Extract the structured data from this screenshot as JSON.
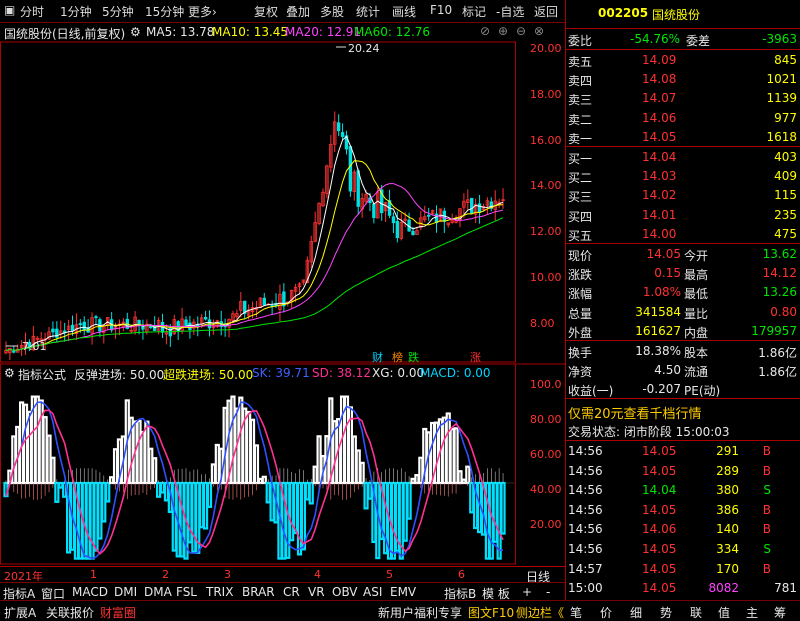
{
  "toolbar": {
    "items": [
      "分时",
      "1分钟",
      "5分钟",
      "15分钟",
      "更多›",
      "复权",
      "叠加",
      "多股",
      "统计",
      "画线",
      "F10",
      "标记",
      "-自选",
      "返回"
    ]
  },
  "header": {
    "stock_title": "国统股份(日线,前复权)",
    "ma5": "MA5: 13.78",
    "ma10": "MA10: 13.45",
    "ma20": "MA20: 12.91",
    "ma60": "MA60: 12.76"
  },
  "price_chart": {
    "y_ticks": [
      "20.00",
      "18.00",
      "16.00",
      "14.00",
      "12.00",
      "10.00",
      "8.00"
    ],
    "high_label": "20.24",
    "low_label": "7.01",
    "badges": {
      "cai": "财",
      "bang": "榜",
      "die": "跌",
      "zhang": "涨"
    }
  },
  "indicator": {
    "title": "指标公式",
    "name": "反弹进场: 50.00",
    "chao": "超跌进场: 50.00",
    "sk": "SK: 39.71",
    "sd": "SD: 38.12",
    "xg": "XG: 0.00",
    "macd": "MACD: 0.00",
    "y_ticks": [
      "100.0",
      "80.00",
      "60.00",
      "40.00",
      "20.00"
    ]
  },
  "timeline": {
    "year": "2021年",
    "months": [
      "1",
      "2",
      "3",
      "4",
      "5",
      "6"
    ],
    "right_label": "日线"
  },
  "tabs": {
    "items": [
      "指标A",
      "窗口",
      "MACD",
      "DMI",
      "DMA",
      "FSL",
      "TRIX",
      "BRAR",
      "CR",
      "VR",
      "OBV",
      "ASI",
      "EMV",
      "指标B",
      "模 板",
      "+",
      "-"
    ]
  },
  "bottom": {
    "left": [
      "扩展A",
      "关联报价",
      "财富圈"
    ],
    "right": [
      "新用户福利专享",
      "图文F10",
      "侧边栏《"
    ],
    "right_tabs": [
      "笔",
      "价",
      "细",
      "势",
      "联",
      "值",
      "主",
      "筹"
    ]
  },
  "quote": {
    "code": "002205",
    "name": "国统股份",
    "weibi_label": "委比",
    "weibi_value": "-54.76%",
    "weicha_label": "委差",
    "weicha_value": "-3963",
    "sells": [
      {
        "label": "卖五",
        "price": "14.09",
        "vol": "845"
      },
      {
        "label": "卖四",
        "price": "14.08",
        "vol": "1021"
      },
      {
        "label": "卖三",
        "price": "14.07",
        "vol": "1139"
      },
      {
        "label": "卖二",
        "price": "14.06",
        "vol": "977"
      },
      {
        "label": "卖一",
        "price": "14.05",
        "vol": "1618"
      }
    ],
    "buys": [
      {
        "label": "买一",
        "price": "14.04",
        "vol": "403"
      },
      {
        "label": "买二",
        "price": "14.03",
        "vol": "409"
      },
      {
        "label": "买三",
        "price": "14.02",
        "vol": "115"
      },
      {
        "label": "买四",
        "price": "14.01",
        "vol": "235"
      },
      {
        "label": "买五",
        "price": "14.00",
        "vol": "475"
      }
    ],
    "stats": [
      {
        "l1": "现价",
        "v1": "14.05",
        "l2": "今开",
        "v2": "13.62"
      },
      {
        "l1": "涨跌",
        "v1": "0.15",
        "l2": "最高",
        "v2": "14.12"
      },
      {
        "l1": "涨幅",
        "v1": "1.08%",
        "l2": "最低",
        "v2": "13.26"
      },
      {
        "l1": "总量",
        "v1": "341584",
        "l2": "量比",
        "v2": "0.80"
      },
      {
        "l1": "外盘",
        "v1": "161627",
        "l2": "内盘",
        "v2": "179957"
      }
    ],
    "stats2": [
      {
        "l1": "换手",
        "v1": "18.38%",
        "l2": "股本",
        "v2": "1.86亿"
      },
      {
        "l1": "净资",
        "v1": "4.50",
        "l2": "流通",
        "v2": "1.86亿"
      },
      {
        "l1": "收益(一)",
        "v1": "-0.207",
        "l2": "PE(动)",
        "v2": ""
      }
    ],
    "promo": "仅需20元查看千档行情",
    "status": "交易状态: 闭市阶段 15:00:03",
    "ticks": [
      {
        "t": "14:56",
        "p": "14.05",
        "v": "291",
        "s": "B"
      },
      {
        "t": "14:56",
        "p": "14.05",
        "v": "289",
        "s": "B"
      },
      {
        "t": "14:56",
        "p": "14.04",
        "v": "380",
        "s": "S"
      },
      {
        "t": "14:56",
        "p": "14.05",
        "v": "386",
        "s": "B"
      },
      {
        "t": "14:56",
        "p": "14.06",
        "v": "140",
        "s": "B"
      },
      {
        "t": "14:56",
        "p": "14.05",
        "v": "334",
        "s": "S"
      },
      {
        "t": "14:57",
        "p": "14.05",
        "v": "170",
        "s": "B"
      },
      {
        "t": "15:00",
        "p": "14.05",
        "v": "8082",
        "s": "781"
      }
    ]
  },
  "colors": {
    "up": "#ff3232",
    "down": "#00e600",
    "ma5": "#ffffff",
    "ma10": "#ffff00",
    "ma20": "#ff44ff",
    "ma60": "#00e600"
  }
}
